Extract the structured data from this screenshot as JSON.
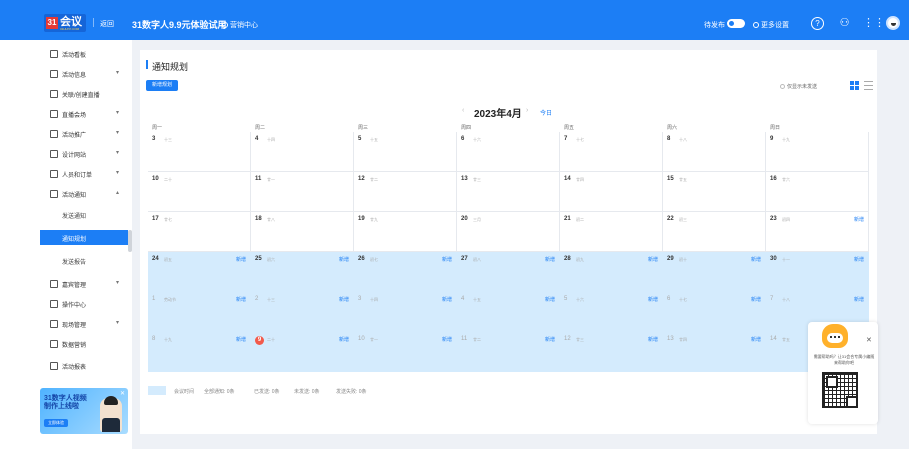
{
  "header": {
    "logo_text": "会议",
    "logo_mark": "31",
    "logo_sub": "31HUIYI.COM",
    "home": "返回",
    "promo": "31数字人9.9元体验试用",
    "center_link": "营销中心",
    "publish_label": "待发布",
    "settings_label": "更多设置"
  },
  "sidebar": {
    "items": [
      {
        "label": "活动看板"
      },
      {
        "label": "活动信息"
      },
      {
        "label": "关联/创建直播"
      },
      {
        "label": "直播会场"
      },
      {
        "label": "活动推广"
      },
      {
        "label": "设计网站"
      },
      {
        "label": "人员和订单"
      },
      {
        "label": "活动通知"
      },
      {
        "label": "嘉宾管理"
      },
      {
        "label": "操作中心"
      },
      {
        "label": "现场管理"
      },
      {
        "label": "数据营销"
      },
      {
        "label": "活动报表"
      }
    ],
    "sub_items": [
      {
        "label": "发送通知"
      },
      {
        "label": "通知规划"
      },
      {
        "label": "发送报告"
      }
    ],
    "banner": {
      "line1": "31数字人视频",
      "line2": "制作上线啦",
      "button": "立即体验"
    }
  },
  "main": {
    "title": "通知规划",
    "add_button": "新增规划",
    "only_unsent": "仅显示未发送",
    "month": "2023年4月",
    "today_btn": "今日",
    "weekdays": [
      "周一",
      "周二",
      "周三",
      "周四",
      "周五",
      "周六",
      "周日"
    ],
    "add_label": "新增",
    "weeks": [
      [
        {
          "d": "3",
          "l": "十三"
        },
        {
          "d": "4",
          "l": "十四"
        },
        {
          "d": "5",
          "l": "十五"
        },
        {
          "d": "6",
          "l": "十六"
        },
        {
          "d": "7",
          "l": "十七"
        },
        {
          "d": "8",
          "l": "十八"
        },
        {
          "d": "9",
          "l": "十九"
        }
      ],
      [
        {
          "d": "10",
          "l": "二十"
        },
        {
          "d": "11",
          "l": "廿一"
        },
        {
          "d": "12",
          "l": "廿二"
        },
        {
          "d": "13",
          "l": "廿三"
        },
        {
          "d": "14",
          "l": "廿四"
        },
        {
          "d": "15",
          "l": "廿五"
        },
        {
          "d": "16",
          "l": "廿六"
        }
      ],
      [
        {
          "d": "17",
          "l": "廿七"
        },
        {
          "d": "18",
          "l": "廿八"
        },
        {
          "d": "19",
          "l": "廿九"
        },
        {
          "d": "20",
          "l": "三月"
        },
        {
          "d": "21",
          "l": "初二"
        },
        {
          "d": "22",
          "l": "初三"
        },
        {
          "d": "23",
          "l": "初四"
        }
      ],
      [
        {
          "d": "24",
          "l": "初五"
        },
        {
          "d": "25",
          "l": "初六"
        },
        {
          "d": "26",
          "l": "初七"
        },
        {
          "d": "27",
          "l": "初八"
        },
        {
          "d": "28",
          "l": "初九"
        },
        {
          "d": "29",
          "l": "初十"
        },
        {
          "d": "30",
          "l": "十一"
        }
      ],
      [
        {
          "d": "1",
          "l": "劳动节"
        },
        {
          "d": "2",
          "l": "十三"
        },
        {
          "d": "3",
          "l": "十四"
        },
        {
          "d": "4",
          "l": "十五"
        },
        {
          "d": "5",
          "l": "十六"
        },
        {
          "d": "6",
          "l": "十七"
        },
        {
          "d": "7",
          "l": "十八"
        }
      ],
      [
        {
          "d": "8",
          "l": "十九"
        },
        {
          "d": "9",
          "l": "二十"
        },
        {
          "d": "10",
          "l": "廿一"
        },
        {
          "d": "11",
          "l": "廿二"
        },
        {
          "d": "12",
          "l": "廿三"
        },
        {
          "d": "13",
          "l": "廿四"
        },
        {
          "d": "14",
          "l": "廿五"
        }
      ]
    ],
    "legend": {
      "meeting_time": "会议时间",
      "all": "全部通知: 0条",
      "sent": "已发送: 0条",
      "unsent": "未发送: 0条",
      "failed": "发送失败: 0条"
    }
  },
  "float_help": {
    "text": "需要帮助吗？让31会合专属小编随来帮助你吧"
  },
  "colors": {
    "primary": "#1c7ef5",
    "highlight": "#d4ebfd",
    "today": "#f25a4b"
  }
}
